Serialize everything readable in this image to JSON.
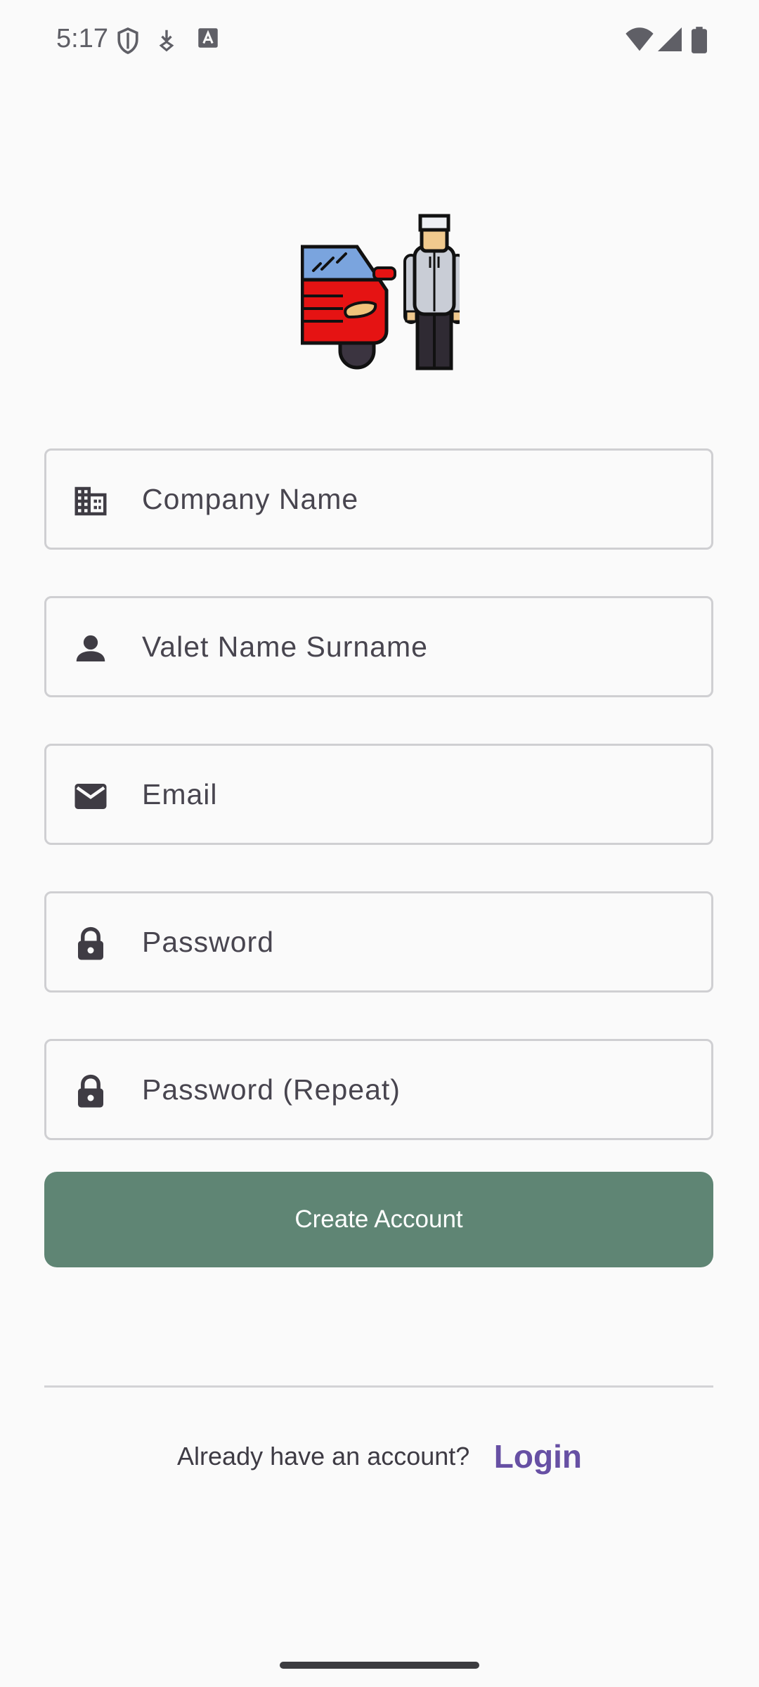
{
  "status_bar": {
    "time": "5:17",
    "left_icons": [
      "shield-icon",
      "download-icon",
      "keyboard-a-icon"
    ],
    "right_icons": [
      "wifi-icon",
      "signal-icon",
      "battery-icon"
    ]
  },
  "logo": {
    "icon": "valet-car-person-illustration"
  },
  "form": {
    "fields": [
      {
        "icon": "building-icon",
        "placeholder": "Company Name"
      },
      {
        "icon": "person-icon",
        "placeholder": "Valet Name Surname"
      },
      {
        "icon": "mail-icon",
        "placeholder": "Email"
      },
      {
        "icon": "lock-icon",
        "placeholder": "Password"
      },
      {
        "icon": "lock-icon",
        "placeholder": "Password (Repeat)"
      }
    ],
    "submit_label": "Create Account"
  },
  "footer": {
    "prompt": "Already have an account?",
    "login_label": "Login"
  },
  "colors": {
    "background": "#FAFAFA",
    "button": "#5F8574",
    "link": "#6750A4"
  }
}
